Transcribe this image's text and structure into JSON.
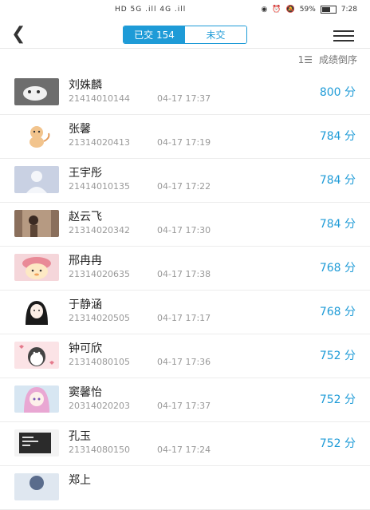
{
  "status_bar": {
    "left": "HD 5G .ill 4G .ill",
    "battery": "59%",
    "battery_level": 0.59,
    "time": "7:28"
  },
  "header": {
    "back_icon": "chevron-left",
    "tabs": [
      {
        "label": "已交 154",
        "active": true
      },
      {
        "label": "未交",
        "active": false
      }
    ],
    "menu_icon": "hamburger"
  },
  "sort": {
    "label": "成绩倒序",
    "icon": "sort-list"
  },
  "accent_color": "#1e9bd7",
  "students": [
    {
      "name": "刘姝麟",
      "id": "21414010144",
      "time": "04-17 17:37",
      "score": "800 分"
    },
    {
      "name": "张馨",
      "id": "21314020413",
      "time": "04-17 17:19",
      "score": "784 分"
    },
    {
      "name": "王宇彤",
      "id": "21414010135",
      "time": "04-17 17:22",
      "score": "784 分"
    },
    {
      "name": "赵云飞",
      "id": "21314020342",
      "time": "04-17 17:30",
      "score": "784 分"
    },
    {
      "name": "邢冉冉",
      "id": "21314020635",
      "time": "04-17 17:38",
      "score": "768 分"
    },
    {
      "name": "于静涵",
      "id": "21314020505",
      "time": "04-17 17:17",
      "score": "768 分"
    },
    {
      "name": "钟可欣",
      "id": "21314080105",
      "time": "04-17 17:36",
      "score": "752 分"
    },
    {
      "name": "窦馨怡",
      "id": "20314020203",
      "time": "04-17 17:37",
      "score": "752 分"
    },
    {
      "name": "孔玉",
      "id": "21314080150",
      "time": "04-17 17:24",
      "score": "752 分"
    },
    {
      "name": "郑上",
      "id": "",
      "time": "",
      "score": ""
    }
  ]
}
